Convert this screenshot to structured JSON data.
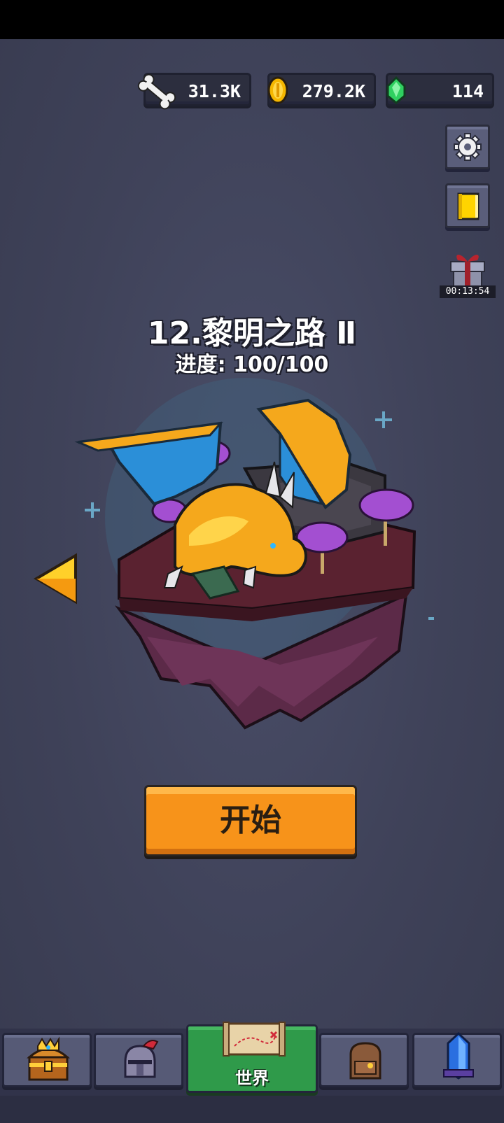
{
  "resources": {
    "bones": {
      "value": "31.3K",
      "icon": "bone-icon"
    },
    "gold": {
      "value": "279.2K",
      "icon": "gold-coin-icon"
    },
    "gems": {
      "value": "114",
      "icon": "green-gem-icon"
    }
  },
  "side_buttons": {
    "settings_icon": "gear-icon",
    "book_icon": "book-icon",
    "gift_icon": "gift-icon",
    "gift_timer": "00:13:54"
  },
  "level": {
    "title": "12.黎明之路 Ⅱ",
    "progress_label": "进度: 100/100",
    "progress_fraction": 1.0
  },
  "start_button": {
    "label": "开始"
  },
  "tabs": [
    {
      "name": "treasure",
      "icon": "treasure-chest-icon",
      "label": ""
    },
    {
      "name": "hero",
      "icon": "knight-helmet-icon",
      "label": ""
    },
    {
      "name": "world",
      "icon": "treasure-map-icon",
      "label": "世界",
      "active": true
    },
    {
      "name": "bag",
      "icon": "backpack-icon",
      "label": ""
    },
    {
      "name": "crystal",
      "icon": "crystal-icon",
      "label": ""
    }
  ],
  "colors": {
    "accent_orange": "#f7931a",
    "active_tab_green": "#2f9a4a",
    "background": "#3e4157"
  }
}
